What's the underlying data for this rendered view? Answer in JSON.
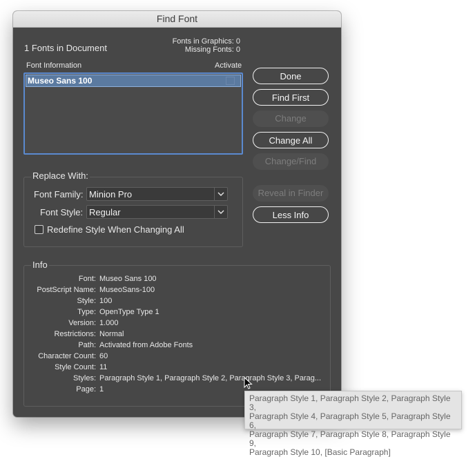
{
  "dialog": {
    "title": "Find Font"
  },
  "summary": {
    "fonts_in_document": "1 Fonts in Document",
    "fonts_in_graphics": "Fonts in Graphics: 0",
    "missing_fonts": "Missing Fonts: 0"
  },
  "font_list": {
    "header_info": "Font Information",
    "header_activate": "Activate",
    "rows": [
      {
        "name": "Museo Sans 100",
        "activate_checked": false
      }
    ]
  },
  "buttons": {
    "done": "Done",
    "find_first": "Find First",
    "change": "Change",
    "change_all": "Change All",
    "change_find": "Change/Find",
    "reveal_in_finder": "Reveal in Finder",
    "less_info": "Less Info"
  },
  "replace_with": {
    "title": "Replace With:",
    "font_family_label": "Font Family:",
    "font_family_value": "Minion Pro",
    "font_style_label": "Font Style:",
    "font_style_value": "Regular",
    "redefine_label": "Redefine Style When Changing All",
    "redefine_checked": false
  },
  "info": {
    "title": "Info",
    "rows": [
      {
        "label": "Font:",
        "value": "Museo Sans 100"
      },
      {
        "label": "PostScript Name:",
        "value": "MuseoSans-100"
      },
      {
        "label": "Style:",
        "value": "100"
      },
      {
        "label": "Type:",
        "value": "OpenType Type 1"
      },
      {
        "label": "Version:",
        "value": "1.000"
      },
      {
        "label": "Restrictions:",
        "value": "Normal"
      },
      {
        "label": "Path:",
        "value": "Activated from Adobe Fonts"
      },
      {
        "label": "Character Count:",
        "value": "60"
      },
      {
        "label": "Style Count:",
        "value": "11"
      },
      {
        "label": "Styles:",
        "value": "Paragraph Style 1, Paragraph Style 2, Paragraph Style 3, Parag..."
      },
      {
        "label": "Page:",
        "value": "1"
      }
    ]
  },
  "tooltip": {
    "lines": [
      "Paragraph Style 1, Paragraph Style 2, Paragraph Style 3,",
      "Paragraph Style 4, Paragraph Style 5, Paragraph Style 6,",
      "Paragraph Style 7, Paragraph Style 8, Paragraph Style 9,",
      "Paragraph Style 10, [Basic Paragraph]"
    ]
  },
  "colors": {
    "dialog_bg": "#474747",
    "selection": "#5b7aa0",
    "focus_ring": "#5b8ad0"
  }
}
